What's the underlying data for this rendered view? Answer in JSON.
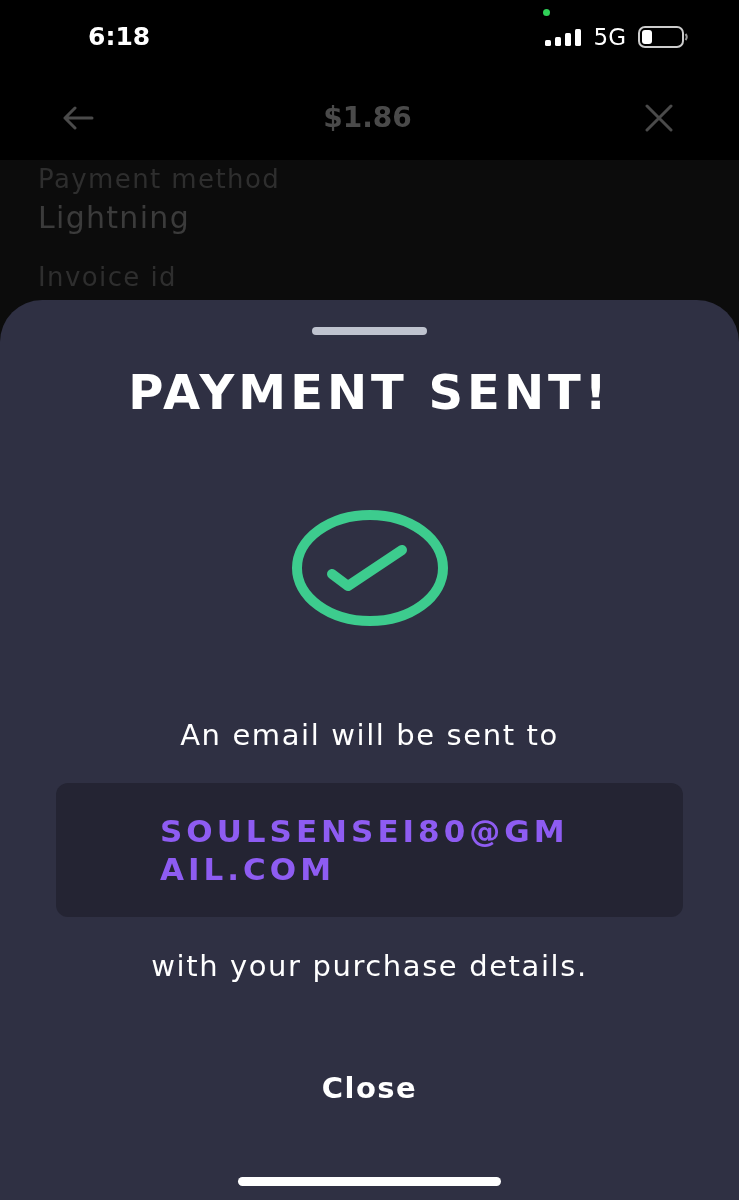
{
  "status_bar": {
    "time": "6:18",
    "network": "5G"
  },
  "header": {
    "title": "$1.86"
  },
  "details": [
    {
      "label": "Payment method",
      "value": "Lightning"
    },
    {
      "label": "Invoice id"
    }
  ],
  "sheet": {
    "title": "PAYMENT SENT!",
    "message_before": "An email will be sent to",
    "email": "SOULSENSEI80@GMAIL.COM",
    "message_after": "with your purchase details.",
    "button": "Close"
  }
}
